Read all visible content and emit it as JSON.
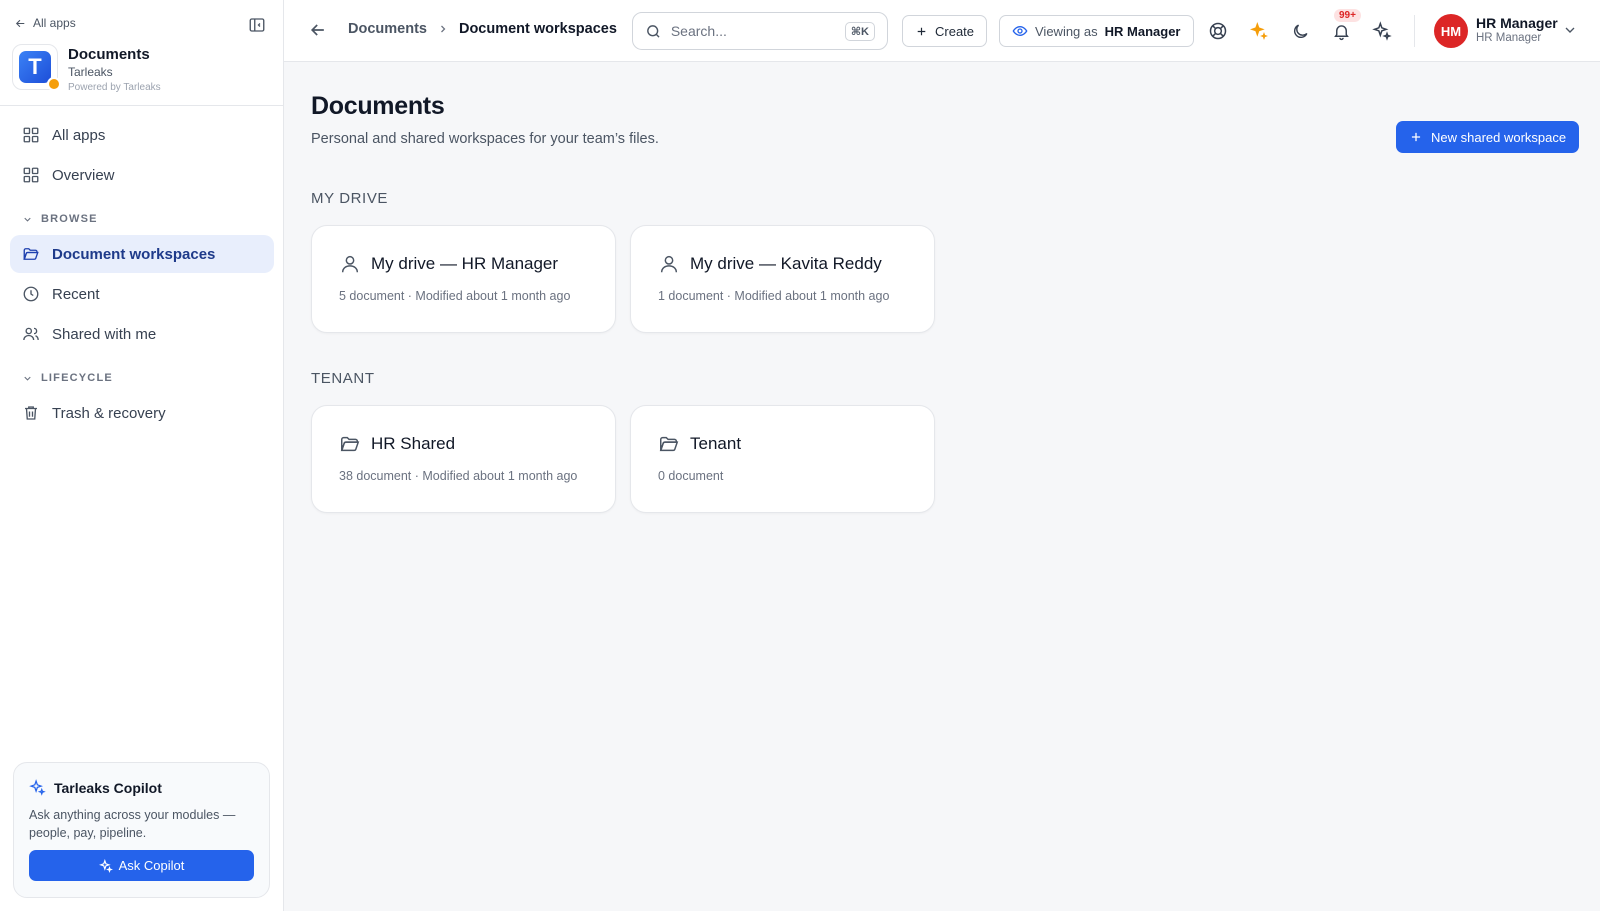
{
  "sidebar": {
    "back_label": "All apps",
    "app": {
      "title": "Documents",
      "subtitle": "Tarleaks",
      "powered": "Powered by Tarleaks",
      "logo_letter": "T"
    },
    "nav_top": [
      {
        "label": "All apps",
        "icon": "grid-icon"
      },
      {
        "label": "Overview",
        "icon": "grid-icon"
      }
    ],
    "browse_label": "BROWSE",
    "browse": [
      {
        "label": "Document workspaces",
        "icon": "folder-open-icon",
        "active": true
      },
      {
        "label": "Recent",
        "icon": "clock-icon"
      },
      {
        "label": "Shared with me",
        "icon": "users-icon"
      }
    ],
    "lifecycle_label": "LIFECYCLE",
    "lifecycle": [
      {
        "label": "Trash & recovery",
        "icon": "trash-icon"
      }
    ],
    "copilot": {
      "title": "Tarleaks Copilot",
      "description": "Ask anything across your modules — people, pay, pipeline.",
      "button": "Ask Copilot"
    }
  },
  "topbar": {
    "breadcrumb": {
      "parent": "Documents",
      "current": "Document workspaces"
    },
    "search": {
      "placeholder": "Search...",
      "shortcut": "⌘K"
    },
    "create_label": "Create",
    "viewing_prefix": "Viewing as",
    "viewing_role": "HR Manager",
    "notifications_count": "99+",
    "user": {
      "initials": "HM",
      "name": "HR Manager",
      "role": "HR Manager"
    }
  },
  "main": {
    "title": "Documents",
    "subtitle": "Personal and shared workspaces for your team’s files.",
    "new_button": "New shared workspace",
    "sections": [
      {
        "label": "MY DRIVE",
        "cards": [
          {
            "title": "My drive — HR Manager",
            "meta": "5 document · Modified about 1 month ago",
            "icon": "user-icon"
          },
          {
            "title": "My drive — Kavita Reddy",
            "meta": "1 document · Modified about 1 month ago",
            "icon": "user-icon"
          }
        ]
      },
      {
        "label": "TENANT",
        "cards": [
          {
            "title": "HR Shared",
            "meta": "38 document · Modified about 1 month ago",
            "icon": "folder-icon"
          },
          {
            "title": "Tenant",
            "meta": "0 document",
            "icon": "folder-icon"
          }
        ]
      }
    ]
  },
  "colors": {
    "accent": "#2563eb",
    "active_nav_bg": "#e8eefc",
    "avatar": "#dc2626",
    "sparkle": "#f59e0b"
  }
}
